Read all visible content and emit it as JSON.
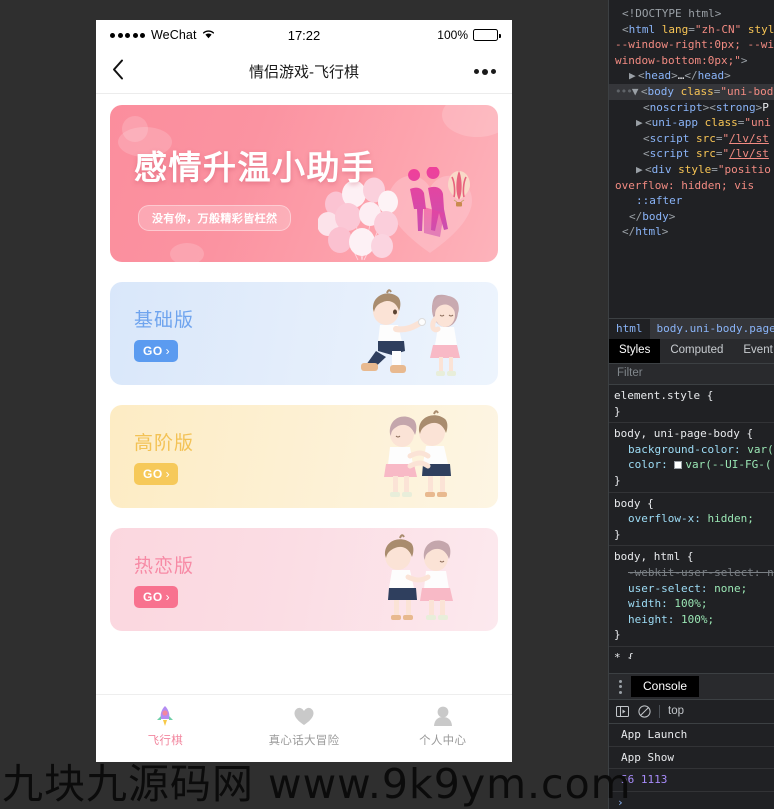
{
  "phone": {
    "status_bar": {
      "carrier": "WeChat",
      "signal_dots": 5,
      "wifi_icon": "wifi-icon",
      "time": "17:22",
      "battery_percent": "100%",
      "battery_icon": "battery-full-icon"
    },
    "nav_bar": {
      "back_icon": "chevron-left-icon",
      "title": "情侣游戏-飞行棋",
      "more_icon": "more-dots-icon"
    },
    "banner": {
      "title": "感情升温小助手",
      "subtitle": "没有你，万般精彩皆枉然",
      "art": "balloons-couple-hotairballoon-illustration",
      "bg_start": "#fb8e9d",
      "bg_end": "#fdb3bb"
    },
    "cards": [
      {
        "title": "基础版",
        "button_label": "GO",
        "button_chevron": "›",
        "accent": "#6fa4ee",
        "button_bg": "#5b9bf0",
        "art": "couple-proposal-illustration"
      },
      {
        "title": "高阶版",
        "button_label": "GO",
        "button_chevron": "›",
        "accent": "#f3c255",
        "button_bg": "#f6c95a",
        "art": "couple-kiss-illustration"
      },
      {
        "title": "热恋版",
        "button_label": "GO",
        "button_chevron": "›",
        "accent": "#f78aa5",
        "button_bg": "#f8728f",
        "art": "couple-holding-hands-illustration"
      }
    ],
    "tab_bar": {
      "active_color": "#f2879f",
      "inactive_color": "#9a9a9a",
      "items": [
        {
          "label": "飞行棋",
          "icon": "rocket-icon",
          "active": true
        },
        {
          "label": "真心话大冒险",
          "icon": "heart-icon",
          "active": false
        },
        {
          "label": "个人中心",
          "icon": "person-icon",
          "active": false
        }
      ]
    }
  },
  "watermark": {
    "text": "九块九源码网 www.9k9ym.com"
  },
  "devtools": {
    "dom_lines": [
      {
        "indent": 1,
        "html": "<span class=\"tok-doc\">&lt;!DOCTYPE html&gt;</span>"
      },
      {
        "indent": 1,
        "html": "<span class=\"tok-punct\">&lt;</span><span class=\"tok-tag\">html</span> <span class=\"tok-attr\">lang</span><span class=\"tok-punct\">=</span><span class=\"tok-val\">\"zh-CN\"</span> <span class=\"tok-attr\">styl</span>"
      },
      {
        "indent": 0,
        "html": "<span class=\"tok-val\">--window-right:0px; --wi</span>"
      },
      {
        "indent": 0,
        "html": "<span class=\"tok-val\">window-bottom:0px;\"</span><span class=\"tok-punct\">&gt;</span>"
      },
      {
        "indent": 2,
        "html": "<span class=\"arrow\">▶</span><span class=\"tok-punct\">&lt;</span><span class=\"tok-tag\">head</span><span class=\"tok-punct\">&gt;</span><span class=\"tok-text\">…</span><span class=\"tok-punct\">&lt;/</span><span class=\"tok-tag\">head</span><span class=\"tok-punct\">&gt;</span>"
      },
      {
        "indent": 0,
        "selected": true,
        "html": "<span class=\"dots-badge\">•••</span><span class=\"arrow\">▼</span><span class=\"tok-punct\">&lt;</span><span class=\"tok-tag\">body</span> <span class=\"tok-attr\">class</span><span class=\"tok-punct\">=</span><span class=\"tok-val\">\"uni-body</span>"
      },
      {
        "indent": 4,
        "html": "<span class=\"tok-punct\">&lt;</span><span class=\"tok-tag\">noscript</span><span class=\"tok-punct\">&gt;&lt;</span><span class=\"tok-tag\">strong</span><span class=\"tok-punct\">&gt;</span><span class=\"tok-text\">P</span>"
      },
      {
        "indent": 3,
        "html": "<span class=\"arrow\">▶</span><span class=\"tok-punct\">&lt;</span><span class=\"tok-tag\">uni-app</span> <span class=\"tok-attr\">class</span><span class=\"tok-punct\">=</span><span class=\"tok-val\">\"uni</span>"
      },
      {
        "indent": 4,
        "html": "<span class=\"tok-punct\">&lt;</span><span class=\"tok-tag\">script</span> <span class=\"tok-attr\">src</span><span class=\"tok-punct\">=</span><span class=\"tok-val\">\"</span><span class=\"tok-link\">/lv/st</span>"
      },
      {
        "indent": 4,
        "html": "<span class=\"tok-punct\">&lt;</span><span class=\"tok-tag\">script</span> <span class=\"tok-attr\">src</span><span class=\"tok-punct\">=</span><span class=\"tok-val\">\"</span><span class=\"tok-link\">/lv/st</span>"
      },
      {
        "indent": 3,
        "html": "<span class=\"arrow\">▶</span><span class=\"tok-punct\">&lt;</span><span class=\"tok-tag\">div</span> <span class=\"tok-attr\">style</span><span class=\"tok-punct\">=</span><span class=\"tok-val\">\"positio</span>"
      },
      {
        "indent": 0,
        "html": "<span class=\"tok-val\">overflow: hidden; vis</span>"
      },
      {
        "indent": 3,
        "html": "<span class=\"tok-pseudo\">::after</span>"
      },
      {
        "indent": 2,
        "html": "<span class=\"tok-punct\">&lt;/</span><span class=\"tok-tag\">body</span><span class=\"tok-punct\">&gt;</span>"
      },
      {
        "indent": 1,
        "html": "<span class=\"tok-punct\">&lt;/</span><span class=\"tok-tag\">html</span><span class=\"tok-punct\">&gt;</span>"
      }
    ],
    "breadcrumbs": [
      {
        "label": "html",
        "active": false
      },
      {
        "label": "body.uni-body.pages-i",
        "active": true
      }
    ],
    "style_tabs": [
      {
        "label": "Styles",
        "active": true
      },
      {
        "label": "Computed",
        "active": false
      },
      {
        "label": "Event",
        "active": false
      }
    ],
    "filter_placeholder": "Filter",
    "rules": [
      {
        "selector": "element.style {",
        "props": [],
        "close": "}"
      },
      {
        "selector": "body, uni-page-body {",
        "props": [
          {
            "name": "background-color",
            "value": "var(",
            "swatch": false
          },
          {
            "name": "color",
            "value": "var(--UI-FG-(",
            "swatch": true
          }
        ],
        "close": "}"
      },
      {
        "selector": "body {",
        "props": [
          {
            "name": "overflow-x",
            "value": "hidden;",
            "swatch": false
          }
        ],
        "close": "}"
      },
      {
        "selector": "body, html {",
        "props": [
          {
            "name": "-webkit-user-select",
            "value": "n",
            "swatch": false,
            "struck": true
          },
          {
            "name": "user-select",
            "value": "none;",
            "swatch": false
          },
          {
            "name": "width",
            "value": "100%;",
            "swatch": false
          },
          {
            "name": "height",
            "value": "100%;",
            "swatch": false
          }
        ],
        "close": "}"
      },
      {
        "selector": "* {",
        "props": [],
        "close": ""
      }
    ],
    "drawer": {
      "kebab_icon": "more-vertical-icon",
      "tab_label": "Console",
      "toolbar": {
        "sidebar_icon": "console-sidebar-icon",
        "clear_icon": "clear-console-icon",
        "context": "top"
      },
      "rows": [
        {
          "text": "App Launch",
          "kind": "label"
        },
        {
          "text": "App Show",
          "kind": "label"
        },
        {
          "text": "56 1113",
          "kind": "num"
        }
      ],
      "prompt": "›"
    }
  }
}
